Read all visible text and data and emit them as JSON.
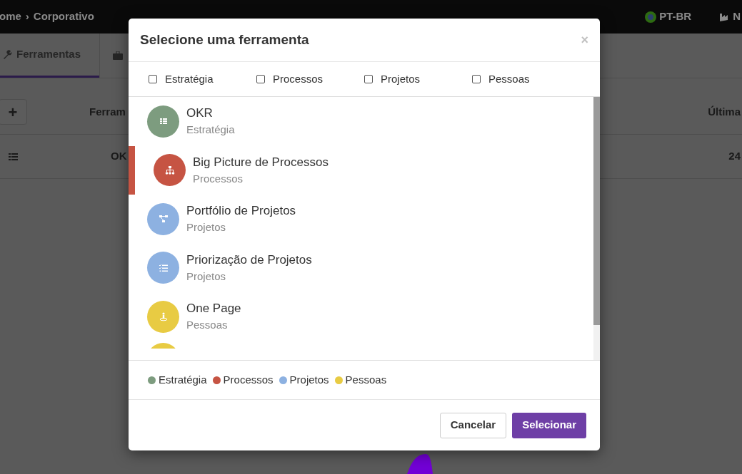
{
  "topbar": {
    "breadcrumb": [
      "ome",
      "Corporativo"
    ],
    "separator": "›",
    "language": "PT-BR",
    "company": "N"
  },
  "tabs": [
    {
      "label": "Ferramentas",
      "selected": true
    }
  ],
  "table": {
    "add_button": "+",
    "columns": [
      "Ferram",
      "Última"
    ],
    "rows": [
      [
        "OK",
        "24"
      ]
    ]
  },
  "dialog": {
    "title": "Selecione uma ferramenta",
    "close": "×",
    "filters": [
      {
        "label": "Estratégia",
        "checked": false
      },
      {
        "label": "Processos",
        "checked": false
      },
      {
        "label": "Projetos",
        "checked": false
      },
      {
        "label": "Pessoas",
        "checked": false
      }
    ],
    "tools": [
      {
        "name": "OKR",
        "category": "Estratégia",
        "color": "#7d9c7f",
        "kind": "list",
        "selected": false
      },
      {
        "name": "Big Picture de Processos",
        "category": "Processos",
        "color": "#c65443",
        "kind": "hierarchy",
        "selected": true
      },
      {
        "name": "Portfólio de Projetos",
        "category": "Projetos",
        "color": "#8db1e1",
        "kind": "flow",
        "selected": false
      },
      {
        "name": "Priorização de Projetos",
        "category": "Projetos",
        "color": "#8db1e1",
        "kind": "checklist",
        "selected": false
      },
      {
        "name": "One Page",
        "category": "Pessoas",
        "color": "#e8cb43",
        "kind": "person",
        "selected": false
      }
    ],
    "legend": [
      {
        "label": "Estratégia",
        "color": "#7d9c7f"
      },
      {
        "label": "Processos",
        "color": "#c65443"
      },
      {
        "label": "Projetos",
        "color": "#8db1e1"
      },
      {
        "label": "Pessoas",
        "color": "#e8cb43"
      }
    ],
    "buttons": [
      {
        "label": "Cancelar",
        "kind": "secondary"
      },
      {
        "label": "Selecionar",
        "kind": "primary"
      }
    ]
  }
}
